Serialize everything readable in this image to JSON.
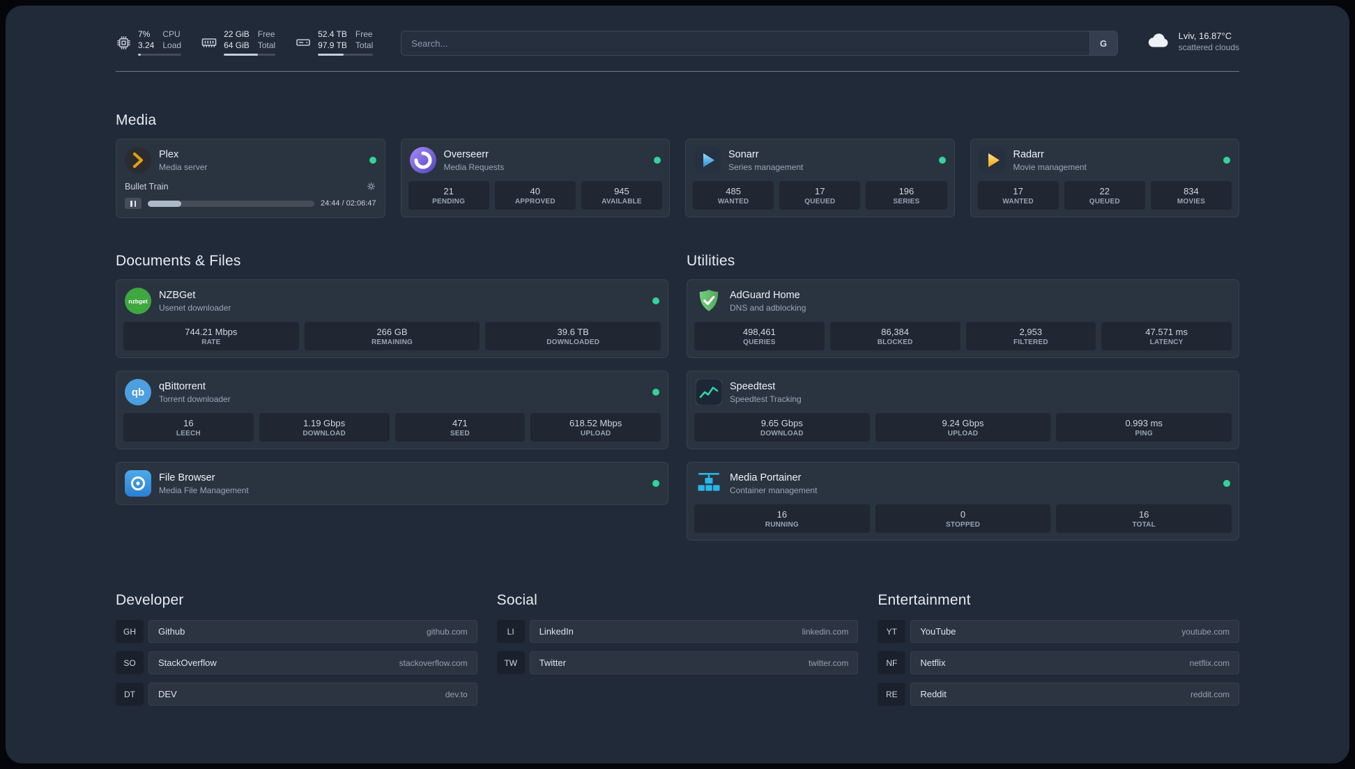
{
  "topbar": {
    "resources": [
      {
        "icon": "cpu-icon",
        "value1": "7%",
        "value2": "3.24",
        "label1": "CPU",
        "label2": "Load",
        "percent": 7
      },
      {
        "icon": "memory-icon",
        "value1": "22 GiB",
        "value2": "64 GiB",
        "label1": "Free",
        "label2": "Total",
        "percent": 66
      },
      {
        "icon": "disk-icon",
        "value1": "52.4 TB",
        "value2": "97.9 TB",
        "label1": "Free",
        "label2": "Total",
        "percent": 47
      }
    ],
    "search": {
      "placeholder": "Search...",
      "provider_label": "G"
    },
    "weather": {
      "location": "Lviv, 16.87°C",
      "condition": "scattered clouds"
    }
  },
  "sections": {
    "media": {
      "title": "Media",
      "cards": [
        {
          "name": "Plex",
          "description": "Media server",
          "icon": "plex-icon",
          "status": "online",
          "player": {
            "track": "Bullet Train",
            "time": "24:44 / 02:06:47",
            "progress": 20
          }
        },
        {
          "name": "Overseerr",
          "description": "Media Requests",
          "icon": "overseerr-icon",
          "status": "online",
          "stats": [
            {
              "value": "21",
              "label": "PENDING"
            },
            {
              "value": "40",
              "label": "APPROVED"
            },
            {
              "value": "945",
              "label": "AVAILABLE"
            }
          ]
        },
        {
          "name": "Sonarr",
          "description": "Series management",
          "icon": "sonarr-icon",
          "status": "online",
          "stats": [
            {
              "value": "485",
              "label": "WANTED"
            },
            {
              "value": "17",
              "label": "QUEUED"
            },
            {
              "value": "196",
              "label": "SERIES"
            }
          ]
        },
        {
          "name": "Radarr",
          "description": "Movie management",
          "icon": "radarr-icon",
          "status": "online",
          "stats": [
            {
              "value": "17",
              "label": "WANTED"
            },
            {
              "value": "22",
              "label": "QUEUED"
            },
            {
              "value": "834",
              "label": "MOVIES"
            }
          ]
        }
      ]
    },
    "documents": {
      "title": "Documents & Files",
      "cards": [
        {
          "name": "NZBGet",
          "description": "Usenet downloader",
          "icon": "nzbget-icon",
          "status": "online",
          "stats": [
            {
              "value": "744.21 Mbps",
              "label": "RATE"
            },
            {
              "value": "266 GB",
              "label": "REMAINING"
            },
            {
              "value": "39.6 TB",
              "label": "DOWNLOADED"
            }
          ]
        },
        {
          "name": "qBittorrent",
          "description": "Torrent downloader",
          "icon": "qbittorrent-icon",
          "status": "online",
          "stats": [
            {
              "value": "16",
              "label": "LEECH"
            },
            {
              "value": "1.19 Gbps",
              "label": "DOWNLOAD"
            },
            {
              "value": "471",
              "label": "SEED"
            },
            {
              "value": "618.52 Mbps",
              "label": "UPLOAD"
            }
          ]
        },
        {
          "name": "File Browser",
          "description": "Media File Management",
          "icon": "filebrowser-icon",
          "status": "online"
        }
      ]
    },
    "utilities": {
      "title": "Utilities",
      "cards": [
        {
          "name": "AdGuard Home",
          "description": "DNS and adblocking",
          "icon": "adguard-icon",
          "stats": [
            {
              "value": "498,461",
              "label": "QUERIES"
            },
            {
              "value": "86,384",
              "label": "BLOCKED"
            },
            {
              "value": "2,953",
              "label": "FILTERED"
            },
            {
              "value": "47.571 ms",
              "label": "LATENCY"
            }
          ]
        },
        {
          "name": "Speedtest",
          "description": "Speedtest Tracking",
          "icon": "speedtest-icon",
          "stats": [
            {
              "value": "9.65 Gbps",
              "label": "DOWNLOAD"
            },
            {
              "value": "9.24 Gbps",
              "label": "UPLOAD"
            },
            {
              "value": "0.993 ms",
              "label": "PING"
            }
          ]
        },
        {
          "name": "Media Portainer",
          "description": "Container management",
          "icon": "portainer-icon",
          "status": "online",
          "stats": [
            {
              "value": "16",
              "label": "RUNNING"
            },
            {
              "value": "0",
              "label": "STOPPED"
            },
            {
              "value": "16",
              "label": "TOTAL"
            }
          ]
        }
      ]
    }
  },
  "bookmarks": {
    "developer": {
      "title": "Developer",
      "items": [
        {
          "abbr": "GH",
          "name": "Github",
          "url": "github.com"
        },
        {
          "abbr": "SO",
          "name": "StackOverflow",
          "url": "stackoverflow.com"
        },
        {
          "abbr": "DT",
          "name": "DEV",
          "url": "dev.to"
        }
      ]
    },
    "social": {
      "title": "Social",
      "items": [
        {
          "abbr": "LI",
          "name": "LinkedIn",
          "url": "linkedin.com"
        },
        {
          "abbr": "TW",
          "name": "Twitter",
          "url": "twitter.com"
        }
      ]
    },
    "entertainment": {
      "title": "Entertainment",
      "items": [
        {
          "abbr": "YT",
          "name": "YouTube",
          "url": "youtube.com"
        },
        {
          "abbr": "NF",
          "name": "Netflix",
          "url": "netflix.com"
        },
        {
          "abbr": "RE",
          "name": "Reddit",
          "url": "reddit.com"
        }
      ]
    }
  },
  "colors": {
    "status_online": "#34d399",
    "plex": "#e5a00d",
    "overseerr": "#7b5bd6",
    "sonarr": "#35c5f4",
    "radarr": "#f6b100",
    "nzbget": "#4da54d",
    "qbittorrent": "#4c9fe0",
    "adguard": "#68bc71",
    "speedtest": "#2dd4a7",
    "portainer": "#29b6e8"
  }
}
